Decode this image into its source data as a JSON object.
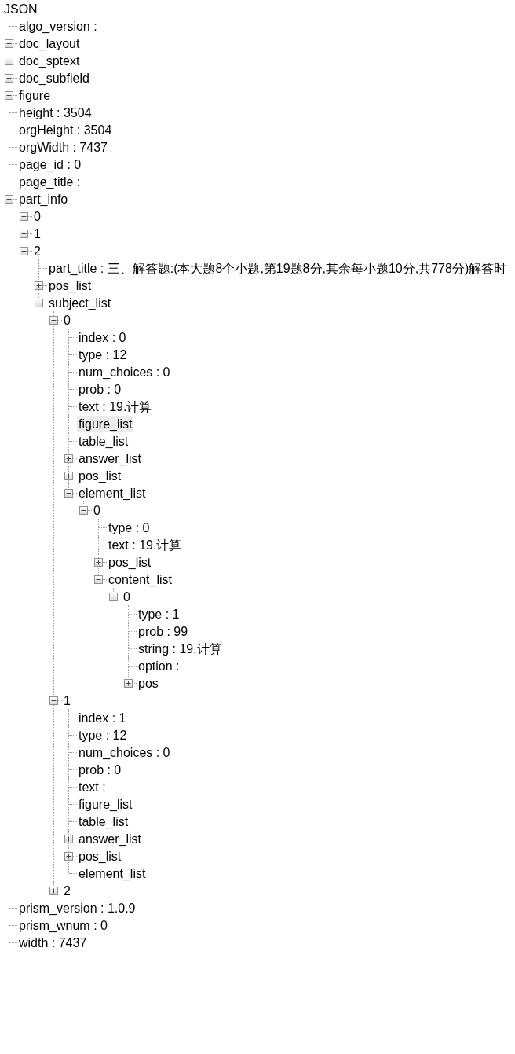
{
  "tree": {
    "label": "JSON",
    "selected": false,
    "children": [
      {
        "kind": "leaf",
        "label": "algo_version :",
        "selected": false
      },
      {
        "kind": "branch",
        "label": "doc_layout",
        "selected": false,
        "expanded": false
      },
      {
        "kind": "branch",
        "label": "doc_sptext",
        "selected": false,
        "expanded": false
      },
      {
        "kind": "branch",
        "label": "doc_subfield",
        "selected": false,
        "expanded": false
      },
      {
        "kind": "branch",
        "label": "figure",
        "selected": false,
        "expanded": false
      },
      {
        "kind": "leaf",
        "label": "height : 3504",
        "selected": false
      },
      {
        "kind": "leaf",
        "label": "orgHeight : 3504",
        "selected": false
      },
      {
        "kind": "leaf",
        "label": "orgWidth : 7437",
        "selected": false
      },
      {
        "kind": "leaf",
        "label": "page_id : 0",
        "selected": false
      },
      {
        "kind": "leaf",
        "label": "page_title :",
        "selected": false
      },
      {
        "kind": "branch",
        "label": "part_info",
        "selected": false,
        "expanded": true,
        "children": [
          {
            "kind": "branch",
            "label": "0",
            "selected": false,
            "expanded": false
          },
          {
            "kind": "branch",
            "label": "1",
            "selected": false,
            "expanded": false
          },
          {
            "kind": "branch",
            "label": "2",
            "selected": false,
            "expanded": true,
            "children": [
              {
                "kind": "leaf",
                "label": "part_title : 三、解答题:(本大题8个小题,第19题8分,其余每小题10分,共778分)解答时",
                "selected": false
              },
              {
                "kind": "branch",
                "label": "pos_list",
                "selected": false,
                "expanded": false
              },
              {
                "kind": "branch",
                "label": "subject_list",
                "selected": false,
                "expanded": true,
                "children": [
                  {
                    "kind": "branch",
                    "label": "0",
                    "selected": false,
                    "expanded": true,
                    "children": [
                      {
                        "kind": "leaf",
                        "label": "index : 0",
                        "selected": false
                      },
                      {
                        "kind": "leaf",
                        "label": "type : 12",
                        "selected": false
                      },
                      {
                        "kind": "leaf",
                        "label": "num_choices : 0",
                        "selected": false
                      },
                      {
                        "kind": "leaf",
                        "label": "prob : 0",
                        "selected": false
                      },
                      {
                        "kind": "leaf",
                        "label": "text : 19.计算",
                        "selected": false
                      },
                      {
                        "kind": "leaf",
                        "label": "figure_list",
                        "selected": true
                      },
                      {
                        "kind": "leaf",
                        "label": "table_list",
                        "selected": false
                      },
                      {
                        "kind": "branch",
                        "label": "answer_list",
                        "selected": false,
                        "expanded": false
                      },
                      {
                        "kind": "branch",
                        "label": "pos_list",
                        "selected": false,
                        "expanded": false
                      },
                      {
                        "kind": "branch",
                        "label": "element_list",
                        "selected": false,
                        "expanded": true,
                        "children": [
                          {
                            "kind": "branch",
                            "label": "0",
                            "selected": false,
                            "expanded": true,
                            "children": [
                              {
                                "kind": "leaf",
                                "label": "type : 0",
                                "selected": false
                              },
                              {
                                "kind": "leaf",
                                "label": "text : 19.计算",
                                "selected": false
                              },
                              {
                                "kind": "branch",
                                "label": "pos_list",
                                "selected": false,
                                "expanded": false
                              },
                              {
                                "kind": "branch",
                                "label": "content_list",
                                "selected": false,
                                "expanded": true,
                                "children": [
                                  {
                                    "kind": "branch",
                                    "label": "0",
                                    "selected": false,
                                    "expanded": true,
                                    "children": [
                                      {
                                        "kind": "leaf",
                                        "label": "type : 1",
                                        "selected": false
                                      },
                                      {
                                        "kind": "leaf",
                                        "label": "prob : 99",
                                        "selected": false
                                      },
                                      {
                                        "kind": "leaf",
                                        "label": "string : 19.计算",
                                        "selected": false
                                      },
                                      {
                                        "kind": "leaf",
                                        "label": "option :",
                                        "selected": false
                                      },
                                      {
                                        "kind": "branch",
                                        "label": "pos",
                                        "selected": false,
                                        "expanded": false
                                      }
                                    ]
                                  }
                                ]
                              }
                            ]
                          }
                        ]
                      }
                    ]
                  },
                  {
                    "kind": "branch",
                    "label": "1",
                    "selected": false,
                    "expanded": true,
                    "children": [
                      {
                        "kind": "leaf",
                        "label": "index : 1",
                        "selected": false
                      },
                      {
                        "kind": "leaf",
                        "label": "type : 12",
                        "selected": false
                      },
                      {
                        "kind": "leaf",
                        "label": "num_choices : 0",
                        "selected": false
                      },
                      {
                        "kind": "leaf",
                        "label": "prob : 0",
                        "selected": false
                      },
                      {
                        "kind": "leaf",
                        "label": "text :",
                        "selected": false
                      },
                      {
                        "kind": "leaf",
                        "label": "figure_list",
                        "selected": false
                      },
                      {
                        "kind": "leaf",
                        "label": "table_list",
                        "selected": false
                      },
                      {
                        "kind": "branch",
                        "label": "answer_list",
                        "selected": false,
                        "expanded": false
                      },
                      {
                        "kind": "branch",
                        "label": "pos_list",
                        "selected": false,
                        "expanded": false
                      },
                      {
                        "kind": "leaf",
                        "label": "element_list",
                        "selected": false
                      }
                    ]
                  },
                  {
                    "kind": "branch",
                    "label": "2",
                    "selected": false,
                    "expanded": false
                  }
                ]
              }
            ]
          }
        ]
      },
      {
        "kind": "leaf",
        "label": "prism_version : 1.0.9",
        "selected": false
      },
      {
        "kind": "leaf",
        "label": "prism_wnum : 0",
        "selected": false
      },
      {
        "kind": "leaf",
        "label": "width : 7437",
        "selected": false
      }
    ]
  }
}
